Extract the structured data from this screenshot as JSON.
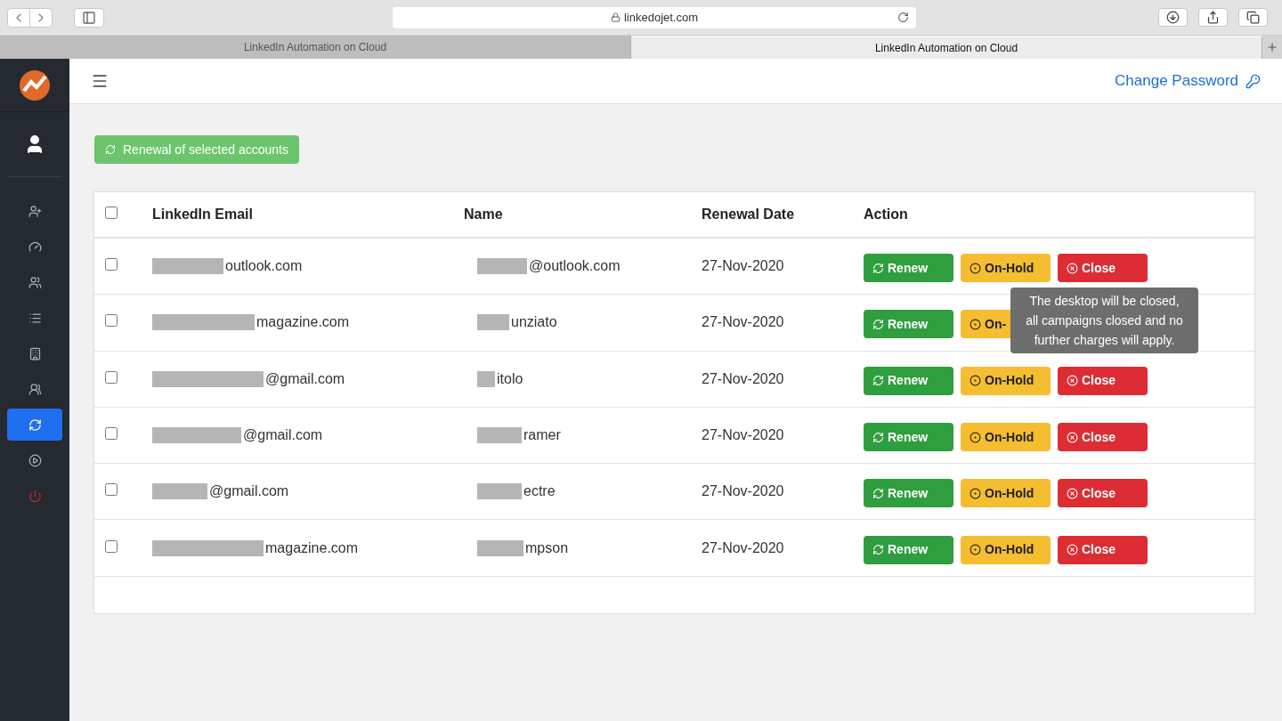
{
  "browser": {
    "url": "linkedojet.com",
    "tabs": [
      {
        "title": "LinkedIn Automation on Cloud",
        "selected": false
      },
      {
        "title": "LinkedIn Automation on Cloud",
        "selected": true
      }
    ]
  },
  "sidebar": {
    "items": [
      {
        "kind": "add-user",
        "selected": false
      },
      {
        "kind": "gauge",
        "selected": false
      },
      {
        "kind": "users",
        "selected": false
      },
      {
        "kind": "list",
        "selected": false
      },
      {
        "kind": "building",
        "selected": false
      },
      {
        "kind": "group",
        "selected": false
      },
      {
        "kind": "refresh",
        "selected": true
      },
      {
        "kind": "play",
        "selected": false
      },
      {
        "kind": "power",
        "selected": false
      }
    ]
  },
  "header": {
    "link": "Change Password"
  },
  "renew_selected_button": "Renewal of selected accounts",
  "table": {
    "select_all": {
      "checked": false
    },
    "columns": [
      "LinkedIn Email",
      "Name",
      "Renewal Date",
      "Action"
    ],
    "rows": [
      {
        "checked": false,
        "email": "outlook.com",
        "name": "@outlook.com",
        "date": "27-Nov-2020",
        "actions": [
          "Renew",
          "On-Hold",
          "Close"
        ]
      },
      {
        "checked": false,
        "email": "magazine.com",
        "name": "unziato",
        "date": "27-Nov-2020",
        "actions": [
          "Renew",
          "On-"
        ]
      },
      {
        "checked": false,
        "email": "@gmail.com",
        "name": "itolo",
        "date": "27-Nov-2020",
        "actions": [
          "Renew",
          "On-Hold",
          "Close"
        ]
      },
      {
        "checked": false,
        "email": "@gmail.com",
        "name": "ramer",
        "date": "27-Nov-2020",
        "actions": [
          "Renew",
          "On-Hold",
          "Close"
        ]
      },
      {
        "checked": false,
        "email": "@gmail.com",
        "name": "ectre",
        "date": "27-Nov-2020",
        "actions": [
          "Renew",
          "On-Hold",
          "Close"
        ]
      },
      {
        "checked": false,
        "email": "magazine.com",
        "name": "mpson",
        "date": "27-Nov-2020",
        "actions": [
          "Renew",
          "On-Hold",
          "Close"
        ]
      }
    ]
  },
  "tooltip": "The desktop will be closed, all campaigns closed and no further charges will apply."
}
